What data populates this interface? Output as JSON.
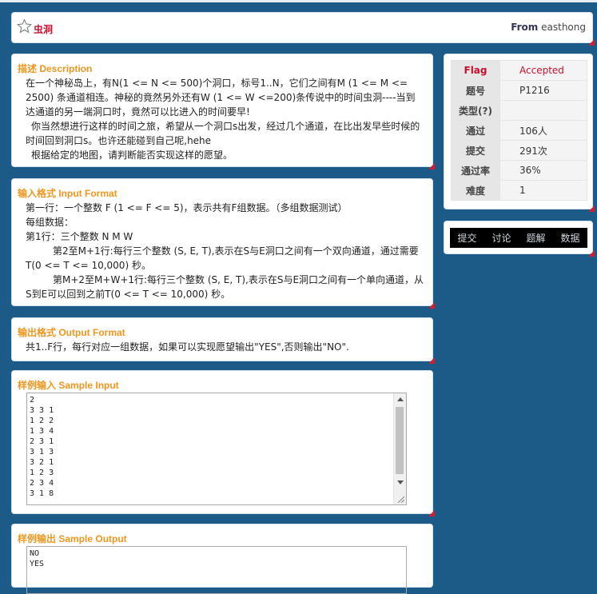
{
  "header": {
    "title": "虫洞",
    "from_label": "From",
    "author": "easthong"
  },
  "description": {
    "title": "描述 Description",
    "paragraphs": [
      "在一个神秘岛上，有N(1 <= N <= 500)个洞口，标号1..N，它们之间有M (1 <= M <= 2500) 条通道相连。神秘的竟然另外还有W (1 <= W <=200)条传说中的时间虫洞----当到达通道的另一端洞口时，竟然可以比进入的时间要早!",
      "你当然想进行这样的时间之旅，希望从一个洞口s出发，经过几个通道，在比出发早些时候的时间回到洞口s。也许还能碰到自己呢,hehe",
      "根据给定的地图，请判断能否实现这样的愿望。"
    ]
  },
  "input_format": {
    "title": "输入格式 Input Format",
    "lines": [
      "第一行：一个整数 F (1 <= F <= 5)，表示共有F组数据。（多组数据测试）",
      "每组数据：",
      "第1行：三个整数 N  M  W",
      "第2至M+1行:每行三个整数 (S, E, T),表示在S与E洞口之间有一个双向通道，通过需要T(0 <= T <= 10,000) 秒。",
      "第M+2至M+W+1行:每行三个整数 (S, E, T),表示在S与E洞口之间有一个单向通道，从S到E可以回到之前T(0 <= T <= 10,000) 秒。"
    ]
  },
  "output_format": {
    "title": "输出格式 Output Format",
    "text": "共1..F行，每行对应一组数据，如果可以实现愿望输出\"YES\",否则输出\"NO\"."
  },
  "sample_input": {
    "title": "样例输入 Sample Input",
    "lines": [
      "2",
      "3 3 1",
      "1 2 2",
      "1 3 4",
      "2 3 1",
      "3 1 3",
      "3 2 1",
      "1 2 3",
      "2 3 4",
      "3 1 8"
    ]
  },
  "sample_output": {
    "title": "样例输出 Sample Output",
    "lines": [
      "NO",
      "YES"
    ]
  },
  "info": {
    "rows": [
      {
        "key": "Flag",
        "value": "Accepted"
      },
      {
        "key": "题号",
        "value": "P1216"
      },
      {
        "key": "类型(?)",
        "value": ""
      },
      {
        "key": "通过",
        "value": "106人"
      },
      {
        "key": "提交",
        "value": "291次"
      },
      {
        "key": "通过率",
        "value": "36%"
      },
      {
        "key": "难度",
        "value": "1"
      }
    ]
  },
  "nav": {
    "items": [
      "提交",
      "讨论",
      "题解",
      "数据"
    ]
  },
  "colors": {
    "background": "#1c5a88",
    "section_title": "#f0961e",
    "accent_red": "#c8102e"
  }
}
